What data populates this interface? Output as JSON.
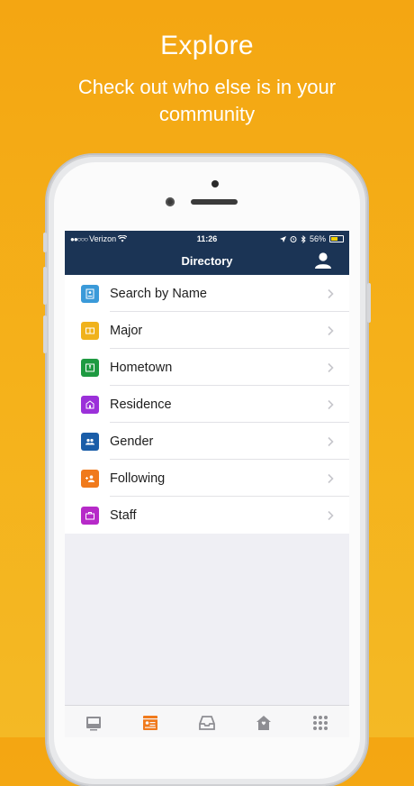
{
  "promo": {
    "title": "Explore",
    "subtitle": "Check out who else is in your community"
  },
  "status_bar": {
    "carrier": "Verizon",
    "time": "11:26",
    "battery": "56%"
  },
  "nav": {
    "title": "Directory",
    "profile_icon": "user-icon"
  },
  "directory": {
    "items": [
      {
        "label": "Search by Name",
        "icon": "id-card-icon",
        "color": "#3a9ad9"
      },
      {
        "label": "Major",
        "icon": "book-icon",
        "color": "#f0b21c"
      },
      {
        "label": "Hometown",
        "icon": "map-icon",
        "color": "#1e9a41"
      },
      {
        "label": "Residence",
        "icon": "building-icon",
        "color": "#9b30d9"
      },
      {
        "label": "Gender",
        "icon": "people-icon",
        "color": "#1a5da8"
      },
      {
        "label": "Following",
        "icon": "follow-icon",
        "color": "#f07a1c"
      },
      {
        "label": "Staff",
        "icon": "briefcase-icon",
        "color": "#b62ac8"
      }
    ]
  },
  "tabs": [
    {
      "name": "news-tab",
      "icon": "newspaper-icon",
      "active": false
    },
    {
      "name": "directory-tab",
      "icon": "directory-icon",
      "active": true
    },
    {
      "name": "inbox-tab",
      "icon": "inbox-icon",
      "active": false
    },
    {
      "name": "home-tab",
      "icon": "home-icon",
      "active": false
    },
    {
      "name": "more-tab",
      "icon": "grid-icon",
      "active": false
    }
  ],
  "colors": {
    "background": "#f4a612",
    "navbar": "#1b3455",
    "tab_active": "#f07a1c",
    "tab_inactive": "#8e8e93"
  }
}
